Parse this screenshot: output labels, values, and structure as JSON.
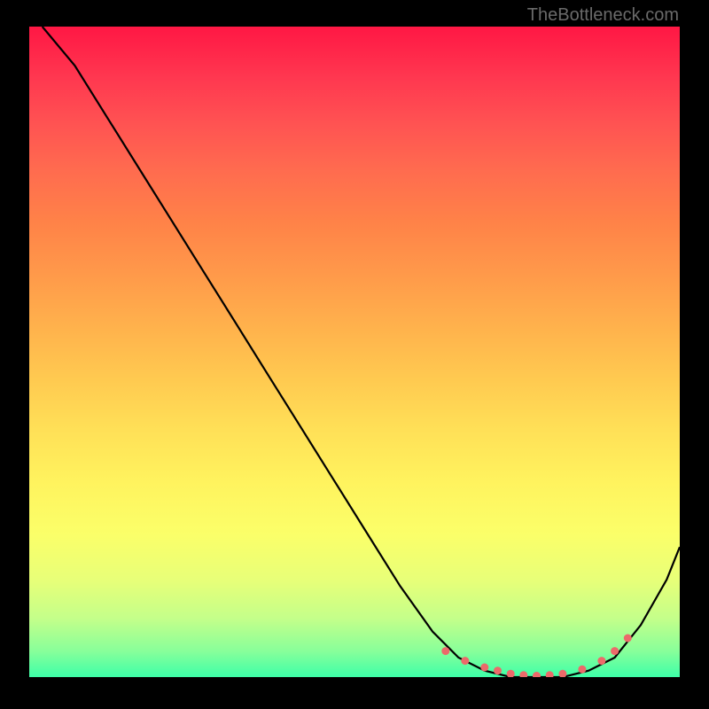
{
  "watermark": "TheBottleneck.com",
  "chart_data": {
    "type": "line",
    "title": "",
    "xlabel": "",
    "ylabel": "",
    "xlim": [
      0,
      100
    ],
    "ylim": [
      0,
      100
    ],
    "series": [
      {
        "name": "bottleneck-curve",
        "x": [
          2,
          7,
          12,
          17,
          22,
          27,
          32,
          37,
          42,
          47,
          52,
          57,
          62,
          66,
          70,
          74,
          78,
          82,
          86,
          90,
          94,
          98,
          100
        ],
        "y": [
          100,
          94,
          86,
          78,
          70,
          62,
          54,
          46,
          38,
          30,
          22,
          14,
          7,
          3,
          1,
          0,
          0,
          0,
          1,
          3,
          8,
          15,
          20
        ]
      }
    ],
    "highlight_points": {
      "name": "optimal-range-dots",
      "x": [
        64,
        67,
        70,
        72,
        74,
        76,
        78,
        80,
        82,
        85,
        88,
        90,
        92
      ],
      "y": [
        4,
        2.5,
        1.5,
        1,
        0.5,
        0.3,
        0.2,
        0.3,
        0.5,
        1.2,
        2.5,
        4,
        6
      ]
    },
    "colors": {
      "curve": "#000000",
      "dots": "#ec6a6a",
      "gradient_top": "#ff1744",
      "gradient_bottom": "#3dffa8"
    }
  }
}
